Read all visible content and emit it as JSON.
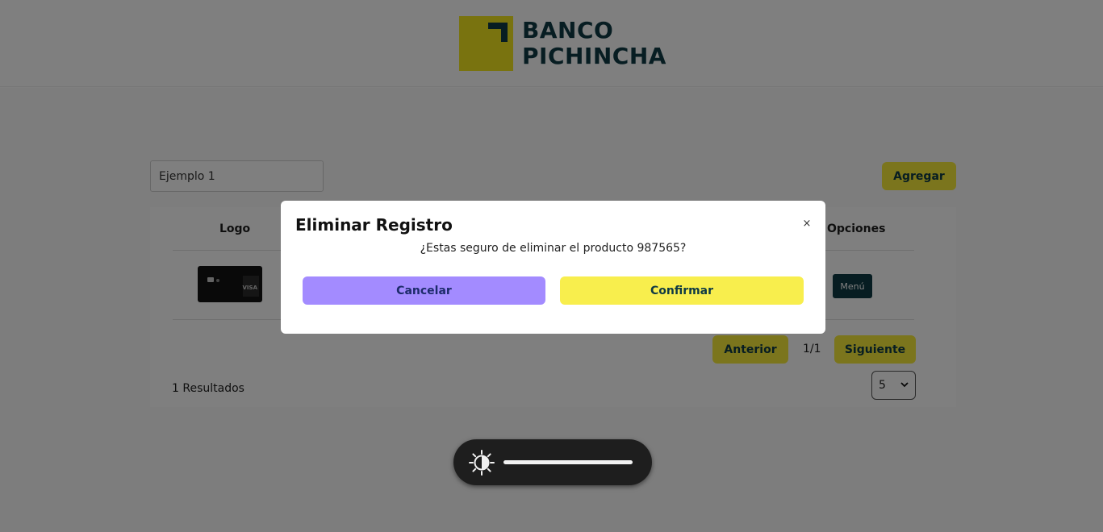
{
  "brand": {
    "line1": "BANCO",
    "line2": "PICHINCHA",
    "colors": {
      "primary": "#0f3a44",
      "accent": "#f2e61f"
    }
  },
  "toolbar": {
    "search_value": "Ejemplo 1",
    "add_label": "Agregar"
  },
  "table": {
    "headers": {
      "logo": "Logo",
      "options": "Opciones"
    },
    "rows": [
      {
        "logo_icon": "credit-card-logo",
        "menu_label": "Menú"
      }
    ]
  },
  "pagination": {
    "prev_label": "Anterior",
    "page_indicator": "1/1",
    "next_label": "Siguiente"
  },
  "footer": {
    "results_text": "1 Resultados",
    "page_size_selected": "5"
  },
  "modal": {
    "title": "Eliminar Registro",
    "close_icon": "×",
    "message": "¿Estas seguro de eliminar el producto 987565?",
    "cancel_label": "Cancelar",
    "confirm_label": "Confirmar",
    "colors": {
      "cancel": "#a38bff",
      "confirm": "#f8ee4d"
    }
  },
  "osd": {
    "icon": "brightness-icon",
    "level": 1.0
  }
}
